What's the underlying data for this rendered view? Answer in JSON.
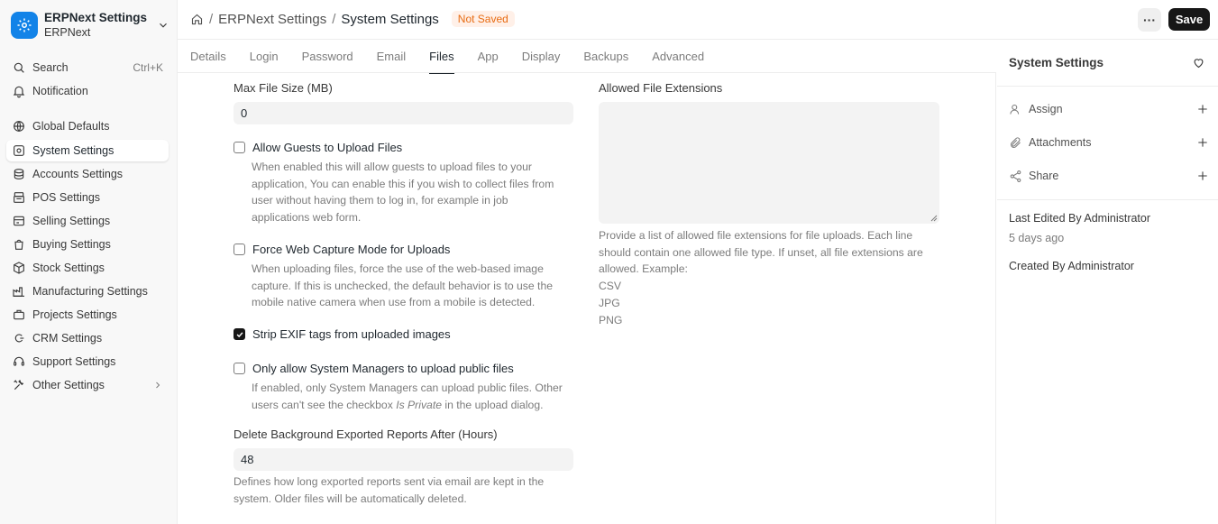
{
  "app": {
    "title": "ERPNext Settings",
    "subtitle": "ERPNext"
  },
  "sidebar": {
    "search_label": "Search",
    "search_shortcut": "Ctrl+K",
    "notification_label": "Notification",
    "items": [
      {
        "label": "Global Defaults",
        "icon": "globe-icon"
      },
      {
        "label": "System Settings",
        "icon": "settings-icon"
      },
      {
        "label": "Accounts Settings",
        "icon": "accounts-icon"
      },
      {
        "label": "POS Settings",
        "icon": "pos-icon"
      },
      {
        "label": "Selling Settings",
        "icon": "selling-icon"
      },
      {
        "label": "Buying Settings",
        "icon": "buying-icon"
      },
      {
        "label": "Stock Settings",
        "icon": "stock-icon"
      },
      {
        "label": "Manufacturing Settings",
        "icon": "factory-icon"
      },
      {
        "label": "Projects Settings",
        "icon": "briefcase-icon"
      },
      {
        "label": "CRM Settings",
        "icon": "crm-icon"
      },
      {
        "label": "Support Settings",
        "icon": "headset-icon"
      },
      {
        "label": "Other Settings",
        "icon": "tools-icon"
      }
    ]
  },
  "topbar": {
    "breadcrumb_parent": "ERPNext Settings",
    "breadcrumb_separator": "/",
    "title": "System Settings",
    "status_badge": "Not Saved",
    "more_label": "···",
    "save_label": "Save"
  },
  "tabs": [
    "Details",
    "Login",
    "Password",
    "Email",
    "Files",
    "App",
    "Display",
    "Backups",
    "Advanced"
  ],
  "active_tab": "Files",
  "form": {
    "max_file_size": {
      "label": "Max File Size (MB)",
      "value": "0"
    },
    "allow_guests": {
      "label": "Allow Guests to Upload Files",
      "checked": false,
      "desc": [
        "When enabled this will allow guests to upload files to your",
        "application, You can enable this if you wish to collect files from",
        "user without having them to log in, for example in job",
        "applications web form."
      ]
    },
    "force_web_capture": {
      "label": "Force Web Capture Mode for Uploads",
      "checked": false,
      "desc": [
        "When uploading files, force the use of the web-based image",
        "capture. If this is unchecked, the default behavior is to use the",
        "mobile native camera when use from a mobile is detected."
      ]
    },
    "strip_exif": {
      "label": "Strip EXIF tags from uploaded images",
      "checked": true
    },
    "only_managers": {
      "label": "Only allow System Managers to upload public files",
      "checked": false,
      "desc_line1": "If enabled, only System Managers can upload public files. Other",
      "desc_line2_a": "users can't see the checkbox ",
      "desc_line2_em": "Is Private",
      "desc_line2_b": " in the upload dialog."
    },
    "delete_reports": {
      "label": "Delete Background Exported Reports After (Hours)",
      "value": "48",
      "desc": [
        "Defines how long exported reports sent via email are kept in the",
        "system. Older files will be automatically deleted."
      ]
    },
    "allowed_extensions": {
      "label": "Allowed File Extensions",
      "value": "",
      "desc": [
        "Provide a list of allowed file extensions for file uploads. Each line",
        "should contain one allowed file type. If unset, all file extensions are",
        "allowed. Example:",
        "CSV",
        "JPG",
        "PNG"
      ]
    }
  },
  "right_panel": {
    "title": "System Settings",
    "assign_label": "Assign",
    "attachments_label": "Attachments",
    "share_label": "Share",
    "last_edited": "Last Edited By Administrator",
    "last_edited_time": "5 days ago",
    "created_by": "Created By Administrator"
  },
  "colors": {
    "accent": "#1283e8",
    "badge_bg": "#fff0e8",
    "badge_text": "#e86c13",
    "primary_button": "#171717"
  }
}
